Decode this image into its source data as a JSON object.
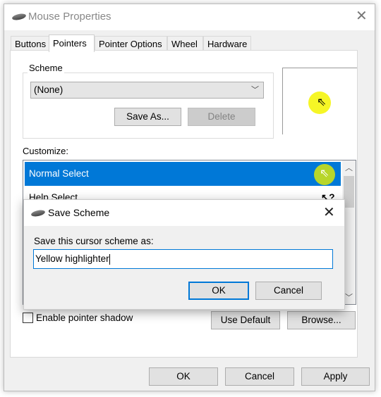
{
  "window": {
    "title": "Mouse Properties",
    "icon": "mouse-icon"
  },
  "tabs": [
    {
      "label": "Buttons"
    },
    {
      "label": "Pointers",
      "selected": true
    },
    {
      "label": "Pointer Options"
    },
    {
      "label": "Wheel"
    },
    {
      "label": "Hardware"
    }
  ],
  "scheme": {
    "label": "Scheme",
    "selected": "(None)",
    "save_as": "Save As...",
    "delete": "Delete"
  },
  "customize": {
    "label": "Customize:",
    "items": [
      {
        "label": "Normal Select",
        "selected": true,
        "icon": "arrow-cursor-icon"
      },
      {
        "label": "Help Select",
        "icon": "help-cursor-icon"
      }
    ]
  },
  "highlight_color": "#f5f500",
  "shadow": {
    "label": "Enable pointer shadow",
    "checked": false
  },
  "use_default": "Use Default",
  "browse": "Browse...",
  "footer": {
    "ok": "OK",
    "cancel": "Cancel",
    "apply": "Apply"
  },
  "dialog": {
    "title": "Save Scheme",
    "prompt": "Save this cursor scheme as:",
    "value": "Yellow highlighter",
    "ok": "OK",
    "cancel": "Cancel"
  }
}
